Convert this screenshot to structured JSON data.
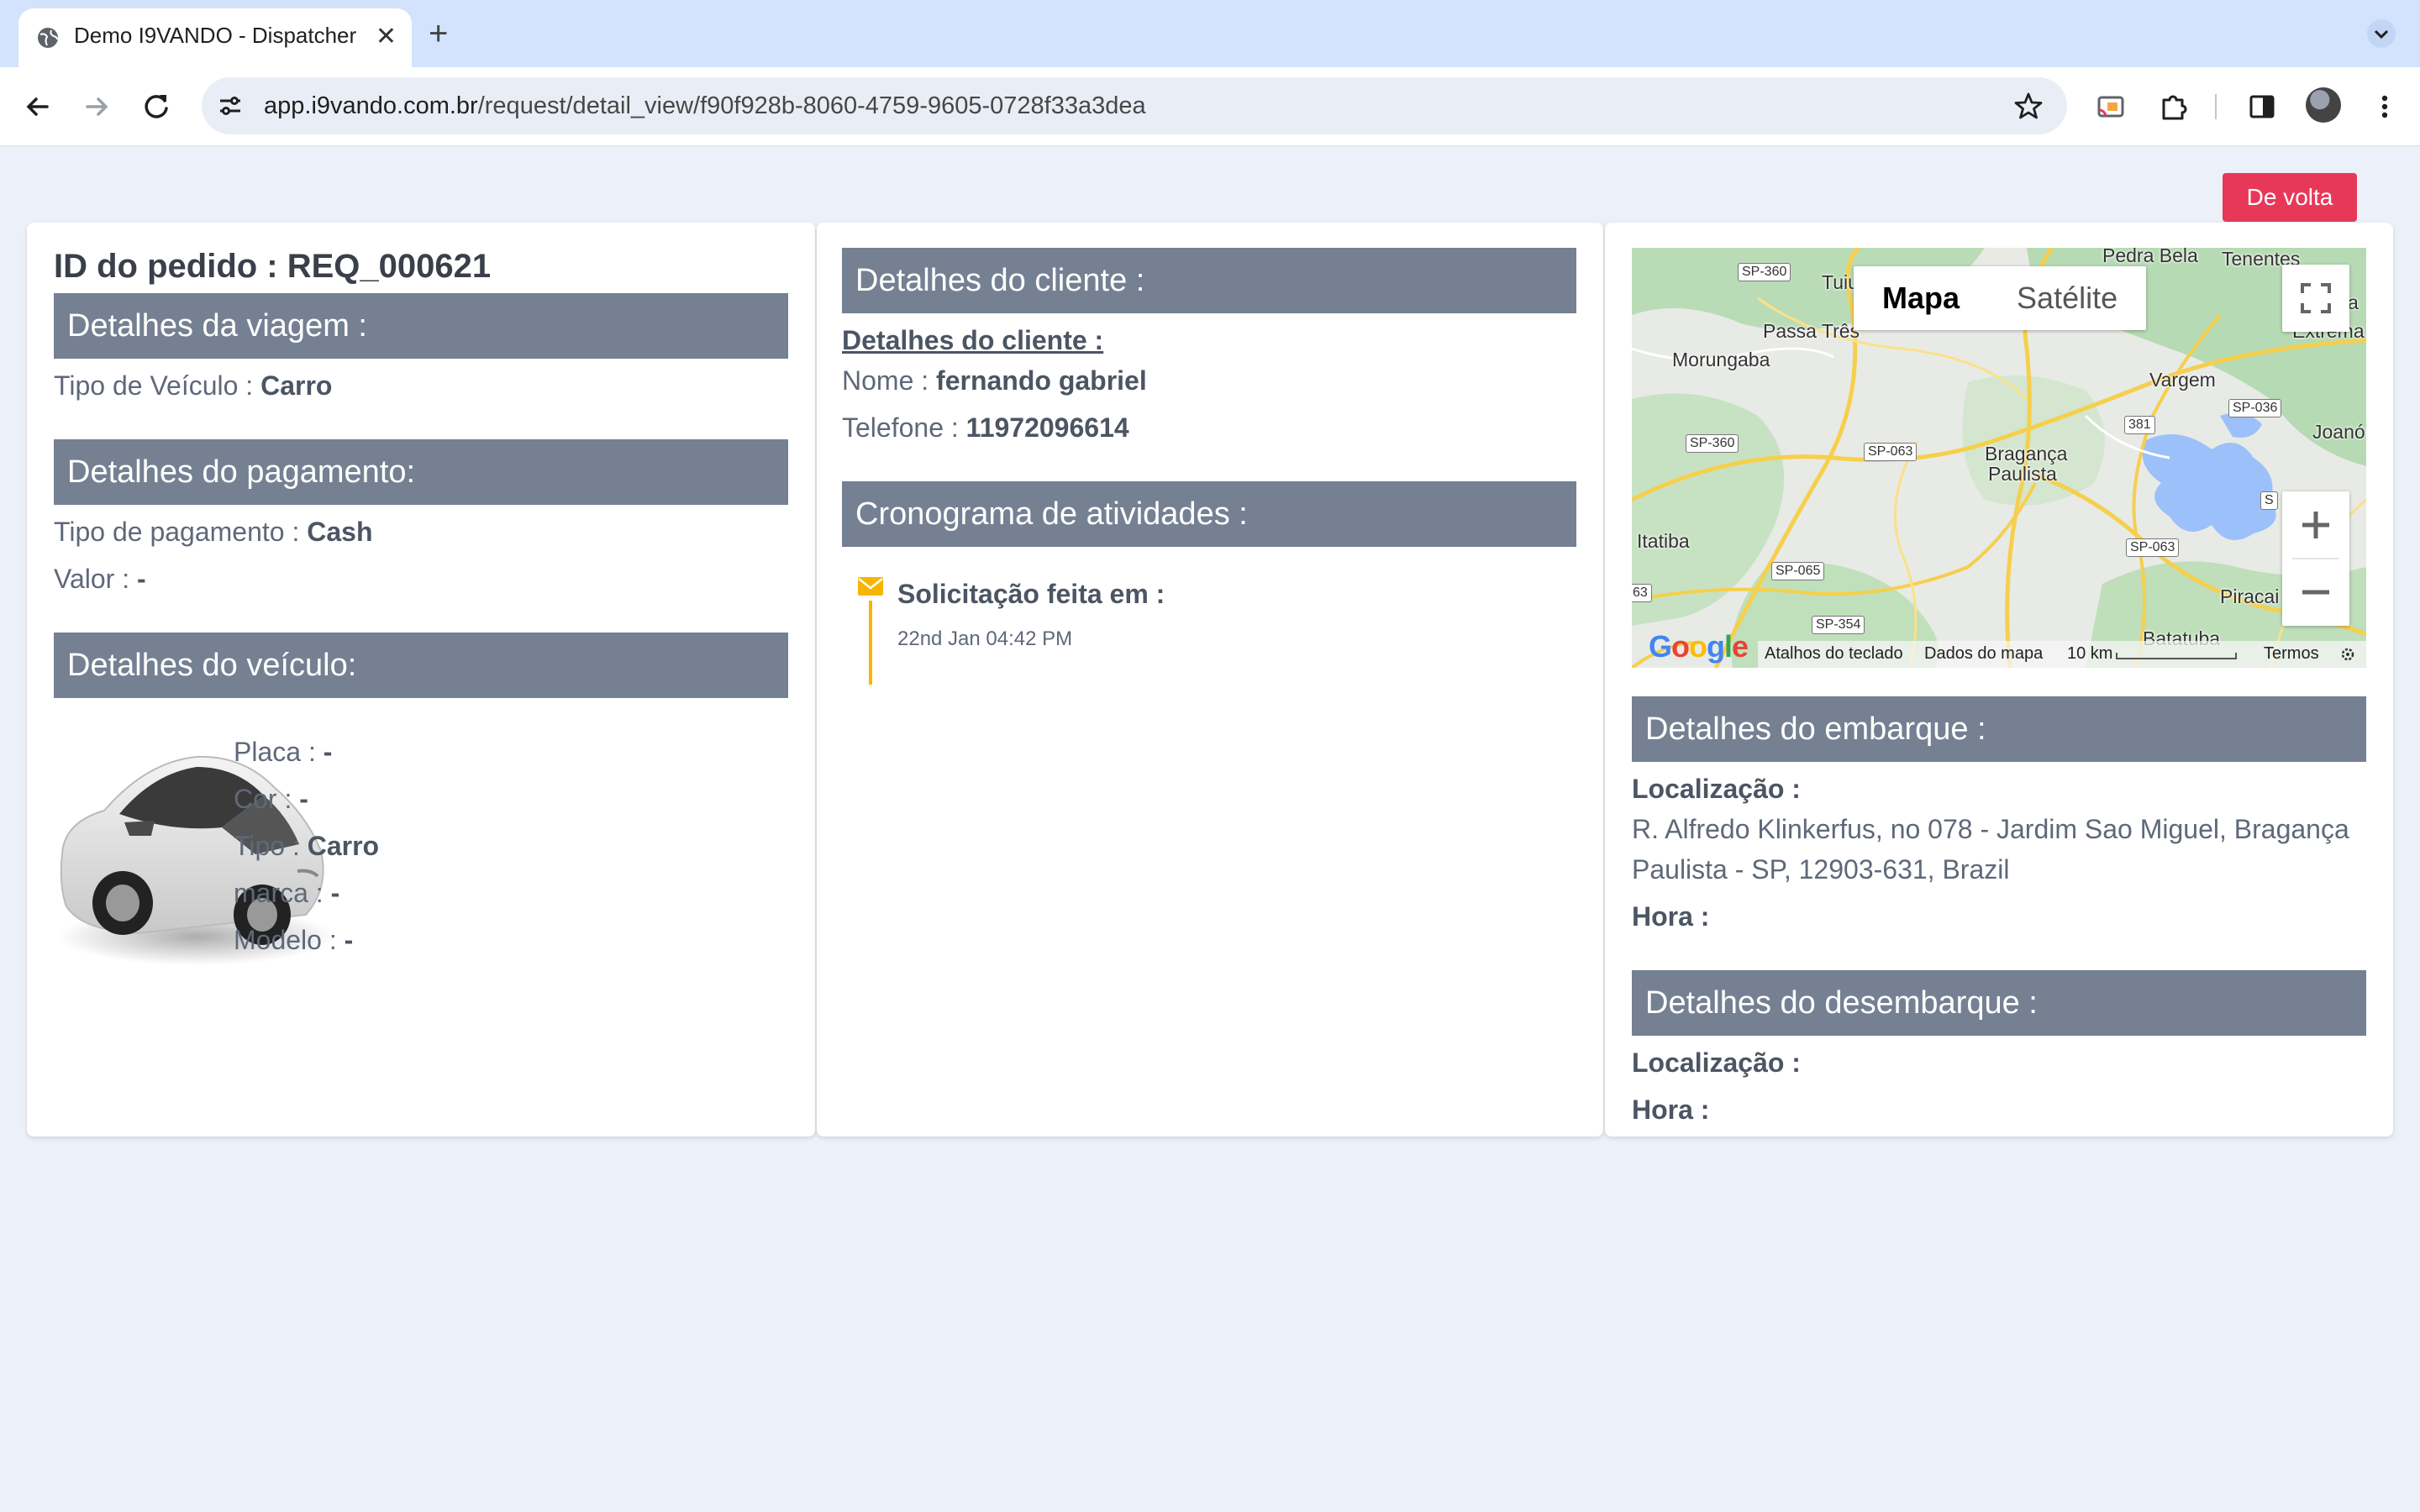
{
  "browser": {
    "tab_title": "Demo I9VANDO - Dispatcher",
    "new_tab": "+",
    "close": "✕",
    "url_host": "app.i9vando.com.br",
    "url_path": "/request/detail_view/f90f928b-8060-4759-9605-0728f33a3dea"
  },
  "page": {
    "back_button": "De volta",
    "order_id_label": "ID do pedido : REQ_000621"
  },
  "trip": {
    "heading": "Detalhes da viagem :",
    "vehicle_type_label": "Tipo de Veículo : ",
    "vehicle_type_value": "Carro"
  },
  "payment": {
    "heading": "Detalhes do pagamento:",
    "type_label": "Tipo de pagamento : ",
    "type_value": "Cash",
    "amount_label": "Valor : ",
    "amount_value": "-"
  },
  "vehicle": {
    "heading": "Detalhes do veículo:",
    "plate_label": "Placa : ",
    "plate_value": "-",
    "color_label": "Cor : ",
    "color_value": "-",
    "type_label": "Tipo : ",
    "type_value": "Carro",
    "brand_label": "marca : ",
    "brand_value": "-",
    "model_label": "Modelo : ",
    "model_value": "-"
  },
  "client": {
    "heading": "Detalhes do cliente :",
    "sub_heading": "Detalhes do cliente :",
    "name_label": "Nome : ",
    "name_value": "fernando gabriel",
    "phone_label": "Telefone : ",
    "phone_value": "11972096614"
  },
  "activity": {
    "heading": "Cronograma de atividades :",
    "items": [
      {
        "title": "Solicitação feita em :",
        "time": "22nd Jan 04:42 PM",
        "icon": "envelope-icon",
        "color": "#f7b500"
      }
    ]
  },
  "map": {
    "type_map": "Mapa",
    "type_satellite": "Satélite",
    "labels": {
      "pedra_bela": "Pedra Bela",
      "tenentes": "Tenentes",
      "tuiu": "Tuiu",
      "passa_tres": "Passa Três",
      "extrema": "Extrema",
      "morungaba": "Morungaba",
      "vargem": "Vargem",
      "joano": "Joanó",
      "braganca": "Bragança",
      "paulista": "Paulista",
      "itatiba": "Itatiba",
      "piracaia": "Piracai",
      "batatuba": "Batatuba"
    },
    "shields": {
      "sp360a": "SP-360",
      "sp360b": "SP-360",
      "sp063a": "SP-063",
      "sp063b": "SP-063",
      "sp036": "SP-036",
      "r381": "381",
      "sp065": "SP-065",
      "sp354": "SP-354",
      "r63": "63",
      "s": "S",
      "a": "a"
    },
    "google": "Google",
    "attribution": {
      "shortcuts": "Atalhos do teclado",
      "data": "Dados do mapa",
      "scale": "10 km",
      "terms": "Termos"
    }
  },
  "pickup": {
    "heading": "Detalhes do embarque :",
    "location_label": "Localização :",
    "address_line1": "R. Alfredo Klinkerfus, no 078 - Jardim Sao Miguel, Bragança",
    "address_line2": "Paulista - SP, 12903-631, Brazil",
    "time_label": "Hora :"
  },
  "dropoff": {
    "heading": "Detalhes do desembarque :",
    "location_label": "Localização :",
    "time_label": "Hora :"
  },
  "colors": {
    "section_header": "#758092",
    "back_button": "#e8385a",
    "timeline": "#f7b500",
    "page_bg": "#ecf0f8"
  }
}
